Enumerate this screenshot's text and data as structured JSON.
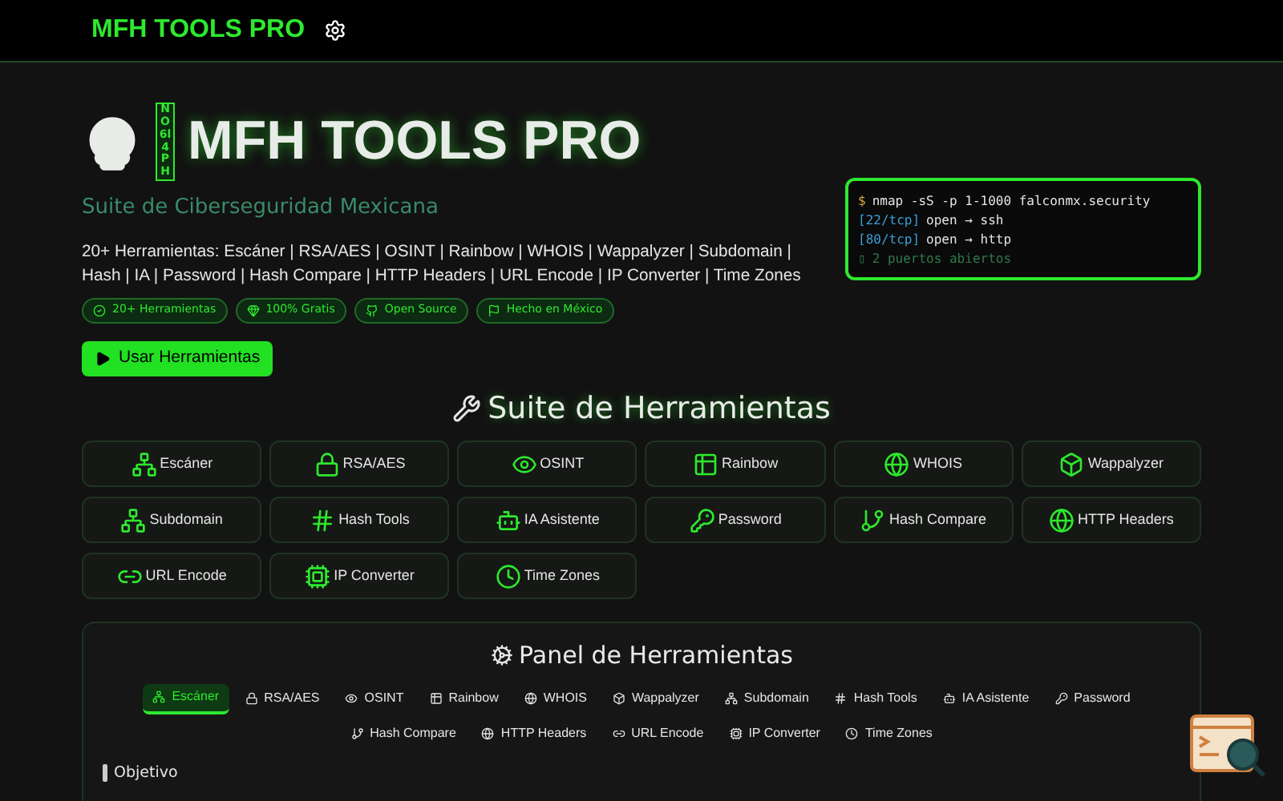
{
  "navbar": {
    "brand": "MFH TOOLS PRO"
  },
  "hero": {
    "title": "MFH TOOLS PRO",
    "badge_vertical": "NO6l4PH",
    "subtitle": "Suite de Ciberseguridad Mexicana",
    "description": "20+ Herramientas: Escáner | RSA/AES | OSINT | Rainbow | WHOIS | Wappalyzer | Subdomain | Hash | IA | Password | Hash Compare | HTTP Headers | URL Encode | IP Converter | Time Zones",
    "badges": [
      "20+ Herramientas",
      "100% Gratis",
      "Open Source",
      "Hecho en México"
    ],
    "button": "Usar Herramientas"
  },
  "terminal": {
    "lines": [
      {
        "kind": "command",
        "prompt": "$",
        "text": "nmap -sS -p 1-1000 falconmx.security"
      },
      {
        "kind": "result",
        "port": "[22/tcp]",
        "text": "open → ssh"
      },
      {
        "kind": "result",
        "port": "[80/tcp]",
        "text": "open → http"
      },
      {
        "kind": "summary",
        "prompt": "▯",
        "text": "2 puertos abiertos"
      }
    ]
  },
  "suite": {
    "title": "Suite de Herramientas",
    "tools": [
      "Escáner",
      "RSA/AES",
      "OSINT",
      "Rainbow",
      "WHOIS",
      "Wappalyzer",
      "Subdomain",
      "Hash Tools",
      "IA Asistente",
      "Password",
      "Hash Compare",
      "HTTP Headers",
      "URL Encode",
      "IP Converter",
      "Time Zones"
    ]
  },
  "panel": {
    "title": "Panel de Herramientas",
    "tabs": [
      {
        "label": "Escáner",
        "selected": true
      },
      {
        "label": "RSA/AES",
        "selected": false
      },
      {
        "label": "OSINT",
        "selected": false
      },
      {
        "label": "Rainbow",
        "selected": false
      },
      {
        "label": "WHOIS",
        "selected": false
      },
      {
        "label": "Wappalyzer",
        "selected": false
      },
      {
        "label": "Subdomain",
        "selected": false
      },
      {
        "label": "Hash Tools",
        "selected": false
      },
      {
        "label": "IA Asistente",
        "selected": false
      },
      {
        "label": "Password",
        "selected": false
      },
      {
        "label": "Hash Compare",
        "selected": false
      },
      {
        "label": "HTTP Headers",
        "selected": false
      },
      {
        "label": "URL Encode",
        "selected": false
      },
      {
        "label": "IP Converter",
        "selected": false
      },
      {
        "label": "Time Zones",
        "selected": false
      }
    ],
    "section_label": "Objetivo"
  }
}
